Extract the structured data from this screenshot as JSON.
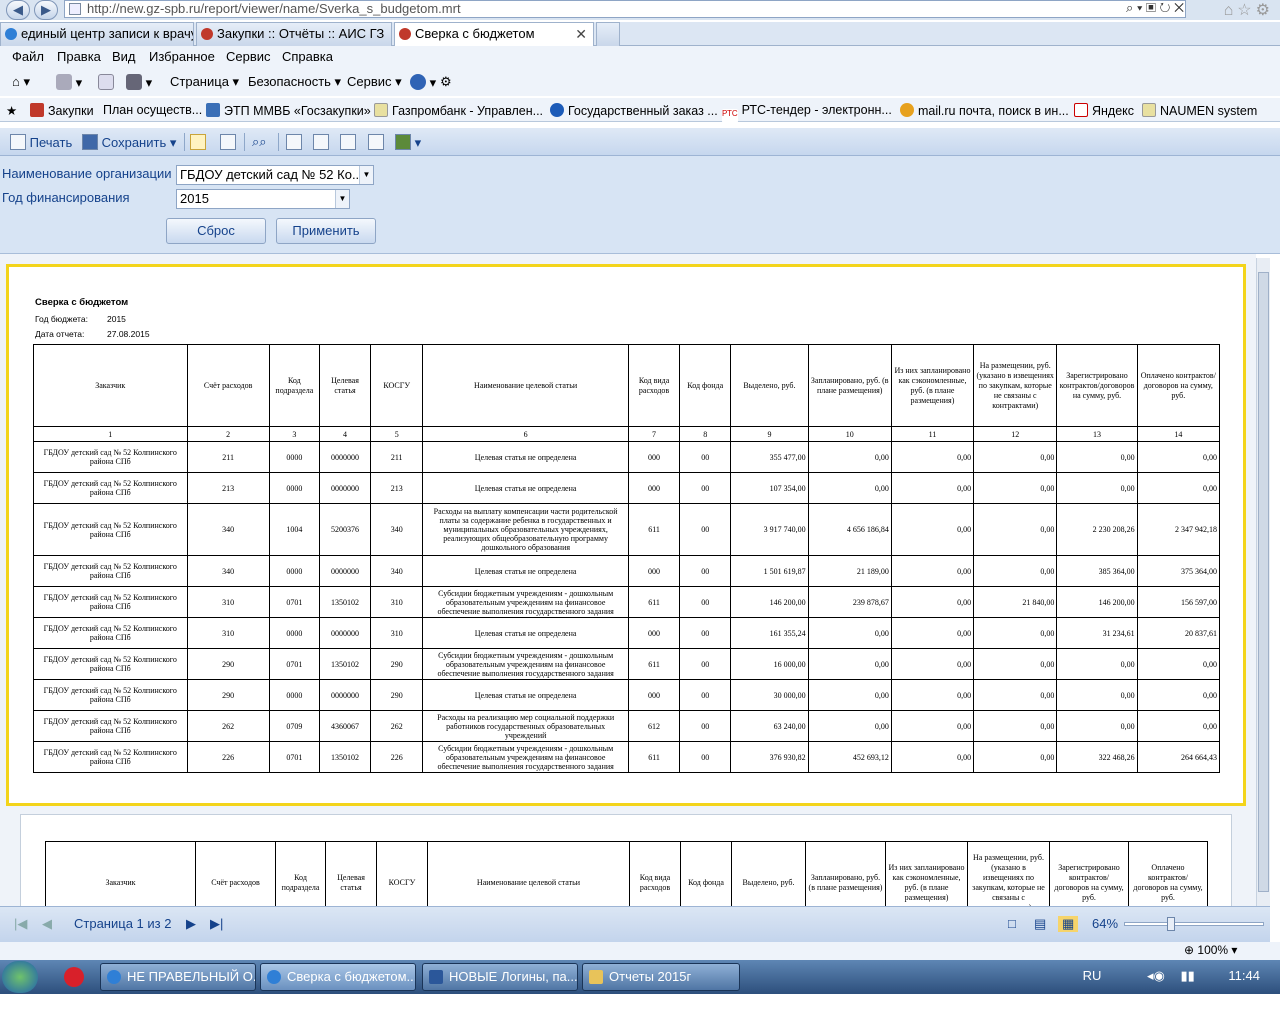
{
  "browser": {
    "url": "http://new.gz-spb.ru/report/viewer/name/Sverka_s_budgetom.mrt",
    "address_tools": "⌕ ▾ ▣ ↻ ✕",
    "tabs": [
      {
        "label": "единый центр записи к врачу...",
        "close": ""
      },
      {
        "label": "Закупки :: Отчёты :: АИС ГЗ",
        "close": ""
      },
      {
        "label": "Сверка с бюджетом",
        "close": "✕"
      }
    ],
    "menu": [
      "Файл",
      "Правка",
      "Вид",
      "Избранное",
      "Сервис",
      "Справка"
    ],
    "commands": {
      "page": "Страница ▾",
      "security": "Безопасность ▾",
      "service": "Сервис ▾"
    },
    "favorites": [
      "Закупки",
      "План осуществ...",
      "ЭТП ММВБ «Госзакупки»",
      "Газпромбанк - Управлен...",
      "Государственный заказ ...",
      "РТС-тендер - электронн...",
      "mail.ru почта, поиск в ин...",
      "Яндекс",
      "NAUMEN system"
    ],
    "zoom": "100%",
    "colors": {
      "accent": "#15428b",
      "page_highlight": "#f3d41b"
    }
  },
  "viewer": {
    "toolbar": {
      "print": "Печать",
      "save": "Сохранить ▾"
    },
    "params": {
      "org_label": "Наименование организации",
      "org_value": "ГБДОУ детский сад № 52 Ко...",
      "year_label": "Год финансирования",
      "year_value": "2015",
      "reset_label": "Сброс",
      "apply_label": "Применить"
    },
    "status": {
      "page_label": "Страница 1 из 2",
      "zoom_label": "64%",
      "zoom_level": 0.64
    }
  },
  "report": {
    "title": "Сверка с бюджетом",
    "budget_year_label": "Год бюджета:",
    "budget_year": "2015",
    "report_date_label": "Дата отчета:",
    "report_date": "27.08.2015",
    "headers": [
      "Заказчик",
      "Счёт расходов",
      "Код подраздела",
      "Целевая статья",
      "КОСГУ",
      "Наименование целевой статьи",
      "Код вида расходов",
      "Код фонда",
      "Выделено, руб.",
      "Запланировано, руб. (в плане размещения)",
      "Из них запланировано как сэкономленные, руб. (в плане размещения)",
      "На размещении, руб. (указано в извещениях по закупкам, которые не связаны с контрактами)",
      "Зарегистрировано контрактов/договоров на сумму, руб.",
      "Оплачено контрактов/договоров на сумму, руб."
    ],
    "numbers": [
      "1",
      "2",
      "3",
      "4",
      "5",
      "6",
      "7",
      "8",
      "9",
      "10",
      "11",
      "12",
      "13",
      "14"
    ],
    "rows": [
      [
        "ГБДОУ детский сад № 52 Колпинского района СПб",
        "211",
        "0000",
        "0000000",
        "211",
        "Целевая статья не определена",
        "000",
        "00",
        "355 477,00",
        "0,00",
        "0,00",
        "0,00",
        "0,00",
        "0,00"
      ],
      [
        "ГБДОУ детский сад № 52 Колпинского района СПб",
        "213",
        "0000",
        "0000000",
        "213",
        "Целевая статья не определена",
        "000",
        "00",
        "107 354,00",
        "0,00",
        "0,00",
        "0,00",
        "0,00",
        "0,00"
      ],
      [
        "ГБДОУ детский сад № 52 Колпинского района СПб",
        "340",
        "1004",
        "5200376",
        "340",
        "Расходы на выплату компенсации части родительской платы за содержание ребенка в государственных и муниципальных образовательных учреждениях, реализующих общеобразовательную программу дошкольного образования",
        "611",
        "00",
        "3 917 740,00",
        "4 656 186,84",
        "0,00",
        "0,00",
        "2 230 208,26",
        "2 347 942,18"
      ],
      [
        "ГБДОУ детский сад № 52 Колпинского района СПб",
        "340",
        "0000",
        "0000000",
        "340",
        "Целевая статья не определена",
        "000",
        "00",
        "1 501 619,87",
        "21 189,00",
        "0,00",
        "0,00",
        "385 364,00",
        "375 364,00"
      ],
      [
        "ГБДОУ детский сад № 52 Колпинского района СПб",
        "310",
        "0701",
        "1350102",
        "310",
        "Субсидии бюджетным учреждениям - дошкольным образовательным учреждениям на финансовое обеспечение выполнения государственного задания",
        "611",
        "00",
        "146 200,00",
        "239 878,67",
        "0,00",
        "21 840,00",
        "146 200,00",
        "156 597,00"
      ],
      [
        "ГБДОУ детский сад № 52 Колпинского района СПб",
        "310",
        "0000",
        "0000000",
        "310",
        "Целевая статья не определена",
        "000",
        "00",
        "161 355,24",
        "0,00",
        "0,00",
        "0,00",
        "31 234,61",
        "20 837,61"
      ],
      [
        "ГБДОУ детский сад № 52 Колпинского района СПб",
        "290",
        "0701",
        "1350102",
        "290",
        "Субсидии бюджетным учреждениям - дошкольным образовательным учреждениям на финансовое обеспечение выполнения государственного задания",
        "611",
        "00",
        "16 000,00",
        "0,00",
        "0,00",
        "0,00",
        "0,00",
        "0,00"
      ],
      [
        "ГБДОУ детский сад № 52 Колпинского района СПб",
        "290",
        "0000",
        "0000000",
        "290",
        "Целевая статья не определена",
        "000",
        "00",
        "30 000,00",
        "0,00",
        "0,00",
        "0,00",
        "0,00",
        "0,00"
      ],
      [
        "ГБДОУ детский сад № 52 Колпинского района СПб",
        "262",
        "0709",
        "4360067",
        "262",
        "Расходы на реализацию мер социальной поддержки работников государственных образовательных учреждений",
        "612",
        "00",
        "63 240,00",
        "0,00",
        "0,00",
        "0,00",
        "0,00",
        "0,00"
      ],
      [
        "ГБДОУ детский сад № 52 Колпинского района СПб",
        "226",
        "0701",
        "1350102",
        "226",
        "Субсидии бюджетным учреждениям - дошкольным образовательным учреждениям на финансовое обеспечение выполнения государственного задания",
        "611",
        "00",
        "376 930,82",
        "452 693,12",
        "0,00",
        "0,00",
        "322 468,26",
        "264 664,43"
      ]
    ]
  },
  "taskbar": {
    "tasks": [
      "НЕ ПРАВЕЛЬНЫЙ О...",
      "Сверка с бюджетом...",
      "НОВЫЕ Логины, па...",
      "Отчеты 2015г"
    ],
    "lang": "RU",
    "time": "11:44"
  }
}
